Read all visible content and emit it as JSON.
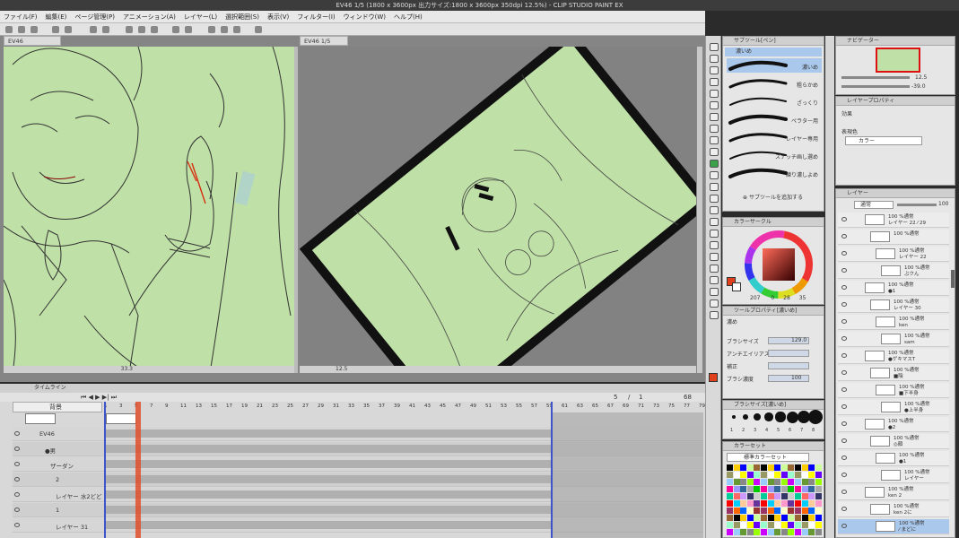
{
  "window": {
    "title": "EV46 1/5 (1800 x 3600px 出力サイズ:1800 x 3600px 350dpi 12.5%) - CLIP STUDIO PAINT EX"
  },
  "menu": [
    "ファイル(F)",
    "編集(E)",
    "ページ管理(P)",
    "アニメーション(A)",
    "レイヤー(L)",
    "選択範囲(S)",
    "表示(V)",
    "フィルター(I)",
    "ウィンドウ(W)",
    "ヘルプ(H)"
  ],
  "canvas_tabs": {
    "left": "EV46",
    "right": "EV46",
    "right_page": "1/5"
  },
  "canvas_status": {
    "left_zoom": "33.3",
    "right_zoom": "12.5"
  },
  "timeline": {
    "title": "タイムライン",
    "track_name": "背景",
    "frame_counter": {
      "current": "5",
      "total": "68",
      "sep": "/",
      "mid": "1"
    },
    "ruler": [
      "1",
      "3",
      "5",
      "7",
      "9",
      "11",
      "13",
      "15",
      "17",
      "19",
      "21",
      "23",
      "25",
      "27",
      "29",
      "31",
      "33",
      "35",
      "37",
      "39",
      "41",
      "43",
      "45",
      "47",
      "49",
      "51",
      "53",
      "55",
      "57",
      "59",
      "61",
      "63",
      "65",
      "67",
      "69",
      "71",
      "73",
      "75",
      "77",
      "79"
    ],
    "tracks": [
      "EV46",
      "●男",
      "ザーダン",
      "2",
      "レイヤー 水2どど",
      "1",
      "レイヤー 31"
    ]
  },
  "subtool": {
    "header": "サブツール[ペン]",
    "group_label": "濃いめ",
    "brushes": [
      "濃いめ",
      "粗らかめ",
      "ざっくり",
      "ペラター用",
      "レイヤー専用",
      "スナッチ画し選め",
      "練り濃しよめ"
    ],
    "add_button": "サブツールを追加する"
  },
  "color_circle": {
    "header": "カラーサークル",
    "h": "28",
    "s": "0",
    "v": "35",
    "hex_value": "207",
    "current_color": "#e0401c"
  },
  "tool_property": {
    "header": "ツールプロパティ[濃いめ]",
    "name": "濃め",
    "fields": [
      {
        "label": "ブラシサイズ",
        "value": "129.0"
      },
      {
        "label": "アンチエイリアス",
        "value": ""
      },
      {
        "label": "補正",
        "value": ""
      },
      {
        "label": "ブラシ濃度",
        "value": "100"
      }
    ]
  },
  "brush_size": {
    "header": "ブラシサイズ[濃いめ]",
    "sizes": [
      "1",
      "2",
      "3",
      "4",
      "5",
      "6",
      "7",
      "8",
      "10",
      "12",
      "15",
      "17",
      "20",
      "25",
      "30",
      "40"
    ]
  },
  "color_set": {
    "header": "カラーセット",
    "set_name": "標準カラーセット"
  },
  "navigator": {
    "header": "ナビゲーター",
    "zoom": "12.5",
    "rotation": "-39.0"
  },
  "layer_property": {
    "header": "レイヤープロパティ",
    "effect_label": "効果",
    "expression_label": "表現色",
    "expression_value": "カラー"
  },
  "layers": {
    "header": "レイヤー",
    "blend_mode": "通常",
    "opacity": "100",
    "items": [
      {
        "pct": "100 %通常",
        "name": "レイヤー 22 ⁄ 29"
      },
      {
        "pct": "100 %通常",
        "name": ""
      },
      {
        "pct": "100 %通常",
        "name": "レイヤー 22"
      },
      {
        "pct": "100 %通常",
        "name": "ぶクん"
      },
      {
        "pct": "100 %通常",
        "name": "●1"
      },
      {
        "pct": "100 %通常",
        "name": "レイヤー 30"
      },
      {
        "pct": "100 %通常",
        "name": "ken"
      },
      {
        "pct": "100 %通常",
        "name": "sam"
      },
      {
        "pct": "100 %通常",
        "name": "●ゲキマスT"
      },
      {
        "pct": "100 %通常",
        "name": "■陰"
      },
      {
        "pct": "100 %通常",
        "name": "■下半身"
      },
      {
        "pct": "100 %通常",
        "name": "●上半身"
      },
      {
        "pct": "100 %通常",
        "name": "●2"
      },
      {
        "pct": "100 %通常",
        "name": "◎顔"
      },
      {
        "pct": "100 %通常",
        "name": "●1"
      },
      {
        "pct": "100 %通常",
        "name": "レイヤー"
      },
      {
        "pct": "100 %通常",
        "name": "ken 2"
      },
      {
        "pct": "100 %通常",
        "name": "ken 2に"
      },
      {
        "pct": "100 %通常",
        "name": "⁄ まどに"
      }
    ]
  },
  "colors": {
    "canvas_paper": "#bfe0a6",
    "ui_bg": "#d8d8d8",
    "accent_red": "#e0401c",
    "selection_blue": "#aac8ec"
  }
}
